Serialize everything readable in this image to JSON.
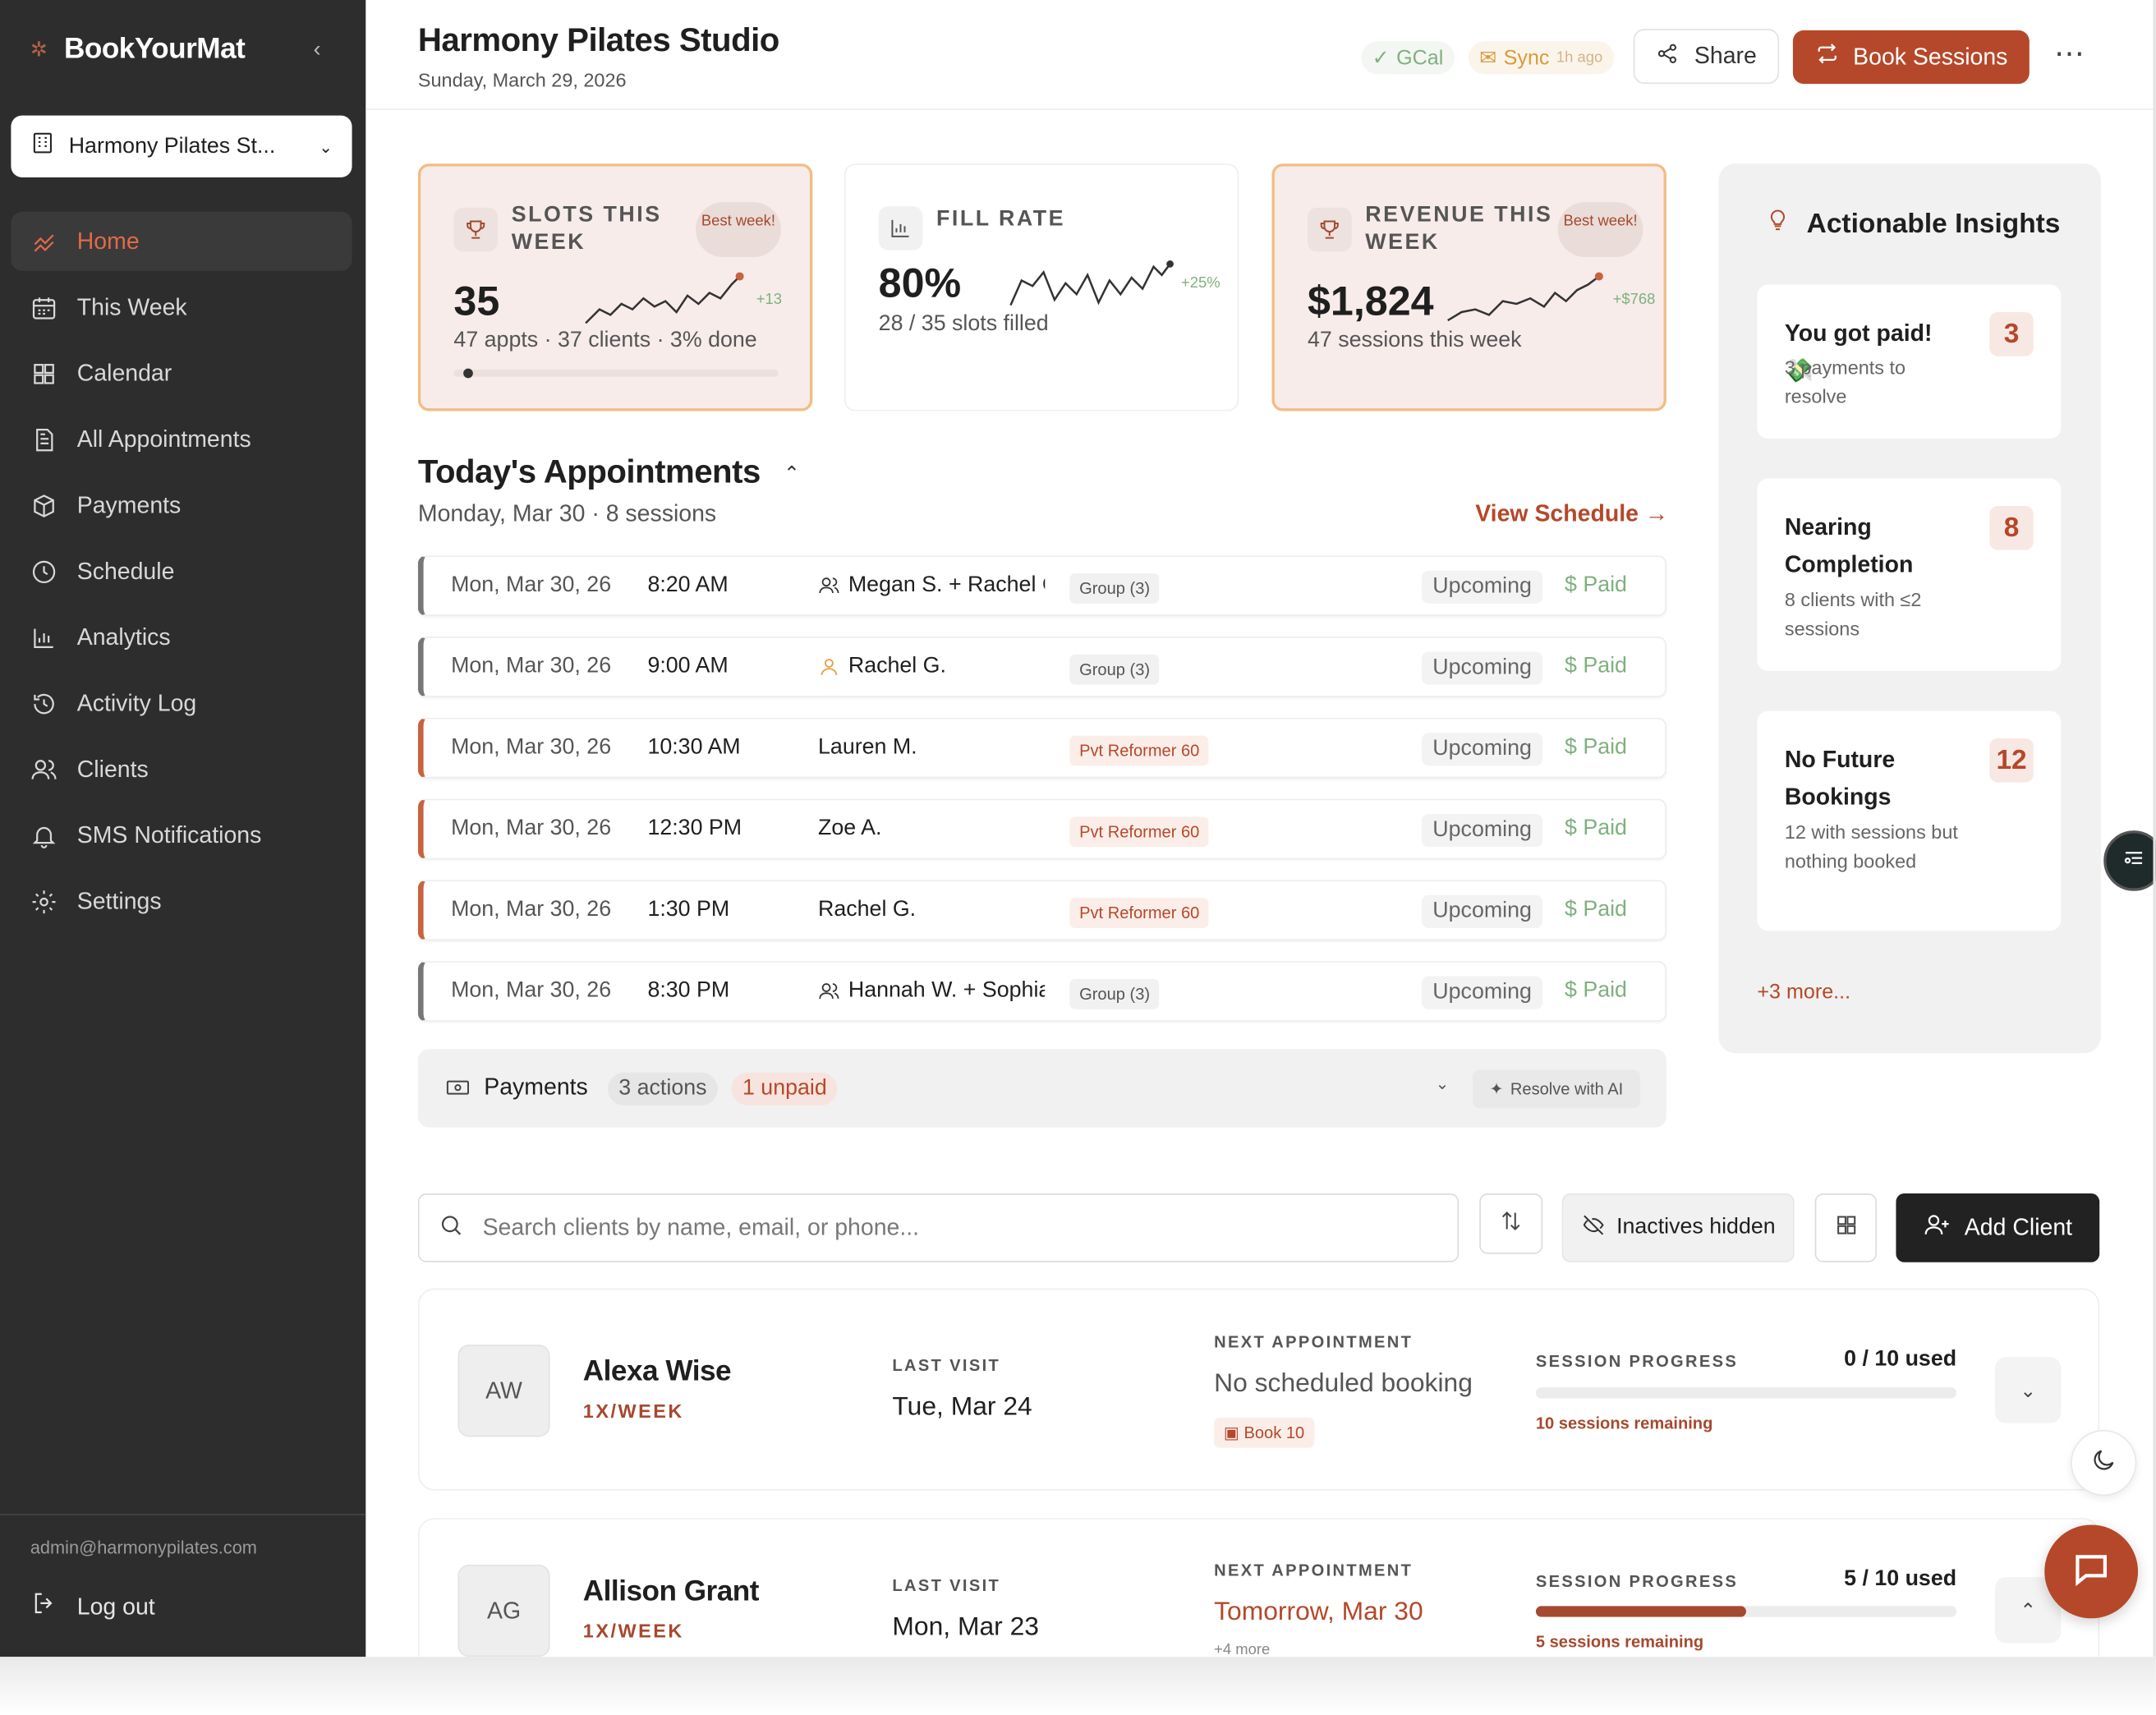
{
  "brand": {
    "name": "BookYourMat",
    "collapse_icon": "chevron-left-icon"
  },
  "studio_selector": {
    "value": "Harmony Pilates St..."
  },
  "nav": [
    {
      "label": "Home",
      "icon": "home-icon",
      "active": true
    },
    {
      "label": "This Week",
      "icon": "calendar-week-icon"
    },
    {
      "label": "Calendar",
      "icon": "grid-icon"
    },
    {
      "label": "All Appointments",
      "icon": "document-icon"
    },
    {
      "label": "Payments",
      "icon": "box-icon"
    },
    {
      "label": "Schedule",
      "icon": "clock-icon"
    },
    {
      "label": "Analytics",
      "icon": "bar-chart-icon"
    },
    {
      "label": "Activity Log",
      "icon": "history-icon"
    },
    {
      "label": "Clients",
      "icon": "users-icon"
    },
    {
      "label": "SMS Notifications",
      "icon": "bell-icon"
    },
    {
      "label": "Settings",
      "icon": "gear-icon"
    }
  ],
  "account": {
    "email": "admin@harmonypilates.com",
    "logout_label": "Log out"
  },
  "header": {
    "title": "Harmony Pilates Studio",
    "date": "Sunday, March 29, 2026",
    "gcal_label": "GCal",
    "sync_label": "Sync",
    "sync_time": "1h ago",
    "share_label": "Share",
    "book_label": "Book Sessions"
  },
  "stats": {
    "slots": {
      "label": "SLOTS THIS WEEK",
      "badge": "Best week!",
      "value": "35",
      "delta": "+13",
      "sub": "47 appts · 37 clients · 3% done",
      "progress": 0.03
    },
    "fill": {
      "label": "FILL RATE",
      "value": "80%",
      "delta": "+25%",
      "sub": "28 / 35 slots filled"
    },
    "revenue": {
      "label": "REVENUE THIS WEEK",
      "badge": "Best week!",
      "value": "$1,824",
      "delta": "+$768",
      "sub": "47 sessions this week"
    }
  },
  "insights": {
    "title": "Actionable Insights",
    "cards": [
      {
        "title": "You got paid! 💸",
        "desc": "3 payments to resolve",
        "count": "3"
      },
      {
        "title": "Nearing Completion",
        "desc": "8 clients with ≤2 sessions",
        "count": "8"
      },
      {
        "title": "No Future Bookings",
        "desc": "12 with sessions but nothing booked",
        "count": "12"
      }
    ],
    "more": "+3 more..."
  },
  "appointments": {
    "title": "Today's Appointments",
    "subtitle": "Monday, Mar 30 · 8 sessions",
    "view_schedule": "View Schedule →",
    "rows": [
      {
        "date": "Mon, Mar 30, 26",
        "time": "8:20 AM",
        "client": "Megan S. + Rachel C",
        "type": "Group (3)",
        "kind": "group",
        "status": "Upcoming",
        "paid": "Paid"
      },
      {
        "date": "Mon, Mar 30, 26",
        "time": "9:00 AM",
        "client": "Rachel G.",
        "type": "Group (3)",
        "kind": "single",
        "status": "Upcoming",
        "paid": "Paid"
      },
      {
        "date": "Mon, Mar 30, 26",
        "time": "10:30 AM",
        "client": "Lauren M.",
        "type": "Pvt Reformer 60",
        "kind": "pvt",
        "status": "Upcoming",
        "paid": "Paid"
      },
      {
        "date": "Mon, Mar 30, 26",
        "time": "12:30 PM",
        "client": "Zoe A.",
        "type": "Pvt Reformer 60",
        "kind": "pvt",
        "status": "Upcoming",
        "paid": "Paid"
      },
      {
        "date": "Mon, Mar 30, 26",
        "time": "1:30 PM",
        "client": "Rachel G.",
        "type": "Pvt Reformer 60",
        "kind": "pvt",
        "status": "Upcoming",
        "paid": "Paid"
      },
      {
        "date": "Mon, Mar 30, 26",
        "time": "8:30 PM",
        "client": "Hannah W. + Sophia",
        "type": "Group (3)",
        "kind": "group",
        "status": "Upcoming",
        "paid": "Paid"
      }
    ],
    "payments": {
      "label": "Payments",
      "actions": "3 actions",
      "unpaid": "1 unpaid",
      "resolve": "Resolve with AI"
    }
  },
  "clients_toolbar": {
    "search_placeholder": "Search clients by name, email, or phone...",
    "inactives": "Inactives hidden",
    "add": "Add Client"
  },
  "clients": [
    {
      "initials": "AW",
      "name": "Alexa Wise",
      "freq": "1X/WEEK",
      "last_visit_label": "LAST VISIT",
      "last_visit": "Tue, Mar 24",
      "next_label": "NEXT APPOINTMENT",
      "next": "No scheduled booking",
      "next_action": "Book 10",
      "progress_label": "SESSION PROGRESS",
      "used": "0 / 10 used",
      "used_fraction": 0.0,
      "remaining": "10 sessions remaining"
    },
    {
      "initials": "AG",
      "name": "Allison Grant",
      "freq": "1X/WEEK",
      "last_visit_label": "LAST VISIT",
      "last_visit": "Mon, Mar 23",
      "next_label": "NEXT APPOINTMENT",
      "next": "Tomorrow, Mar 30",
      "next_more": "+4 more",
      "progress_label": "SESSION PROGRESS",
      "used": "5 / 10 used",
      "used_fraction": 0.5,
      "remaining": "5 sessions remaining"
    }
  ],
  "colors": {
    "accent": "#b5482a",
    "sidebar": "#2d2d2d",
    "paid": "#7fb07f",
    "highlight_border": "#f1bd84"
  }
}
